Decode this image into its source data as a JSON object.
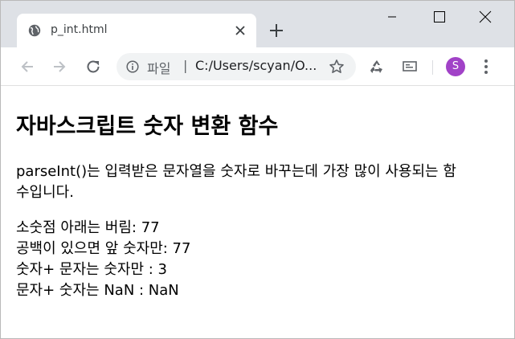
{
  "window": {
    "tab_title": "p_int.html",
    "minimize_icon": "minimize-icon",
    "maximize_icon": "maximize-icon",
    "close_icon": "close-icon"
  },
  "toolbar": {
    "omnibox_label": "파일",
    "omnibox_separator": "|",
    "url": "C:/Users/scyan/O...",
    "avatar_letter": "S",
    "avatar_color": "#a142c7"
  },
  "page": {
    "heading": "자바스크립트 숫자 변환 함수",
    "intro": "parseInt()는 입력받은 문자열을 숫자로 바꾸는데 가장 많이 사용되는 함수입니다.",
    "results": [
      "소숫점 아래는 버림: 77",
      "공백이 있으면 앞 숫자만: 77",
      "숫자+ 문자는 숫자만 : 3",
      "문자+ 숫자는 NaN : NaN"
    ]
  },
  "colors": {
    "titlebar": "#dee1e6",
    "icon": "#5f6368"
  }
}
